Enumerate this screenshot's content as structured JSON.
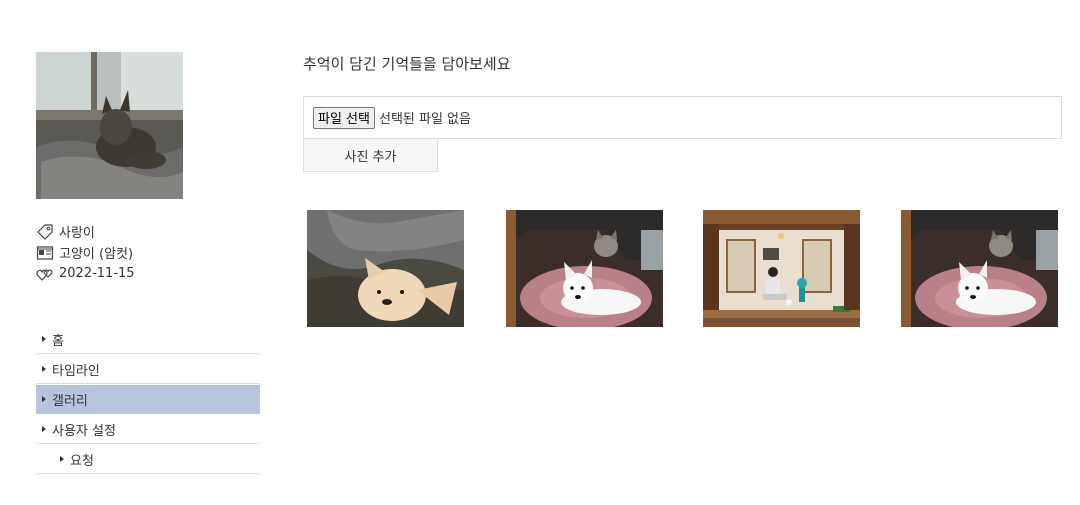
{
  "profile": {
    "name": "사랑이",
    "species": "고양이 (암컷)",
    "date": "2022-11-15"
  },
  "nav": {
    "items": [
      {
        "label": "홈"
      },
      {
        "label": "타임라인"
      },
      {
        "label": "갤러리",
        "active": true
      },
      {
        "label": "사용자 설정"
      },
      {
        "label": "요청",
        "sub": true
      }
    ]
  },
  "main": {
    "heading": "추억이 담긴 기억들을 담아보세요",
    "file_button": "파일 선택",
    "file_status": "선택된 파일 없음",
    "add_button": "사진 추가"
  },
  "gallery": {
    "photos": [
      {
        "subject": "dog-under-arm"
      },
      {
        "subject": "dog-on-cushion-with-cat"
      },
      {
        "subject": "person-in-hanok-room"
      },
      {
        "subject": "dog-on-cushion-with-cat"
      }
    ]
  },
  "colors": {
    "active_nav": "#b8c4dd",
    "border": "#dcdcdc"
  }
}
